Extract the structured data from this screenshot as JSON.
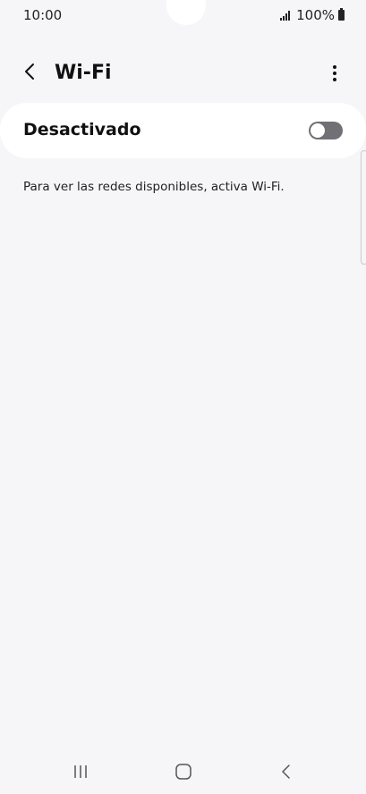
{
  "status_bar": {
    "time": "10:00",
    "battery_text": "100%",
    "icons": [
      "signal-icon",
      "battery-icon"
    ]
  },
  "header": {
    "title": "Wi-Fi",
    "back_icon": "chevron-left-icon",
    "more_icon": "more-vert-icon"
  },
  "wifi_toggle": {
    "label": "Desactivado",
    "state": "off"
  },
  "info": {
    "message": "Para ver las redes disponibles, activa Wi-Fi."
  },
  "nav_bar": {
    "icons": [
      "recent-apps-icon",
      "home-icon",
      "back-icon"
    ]
  },
  "colors": {
    "background": "#f6f6f8",
    "card": "#ffffff",
    "toggle_track_off": "#707075",
    "text": "#111111"
  }
}
